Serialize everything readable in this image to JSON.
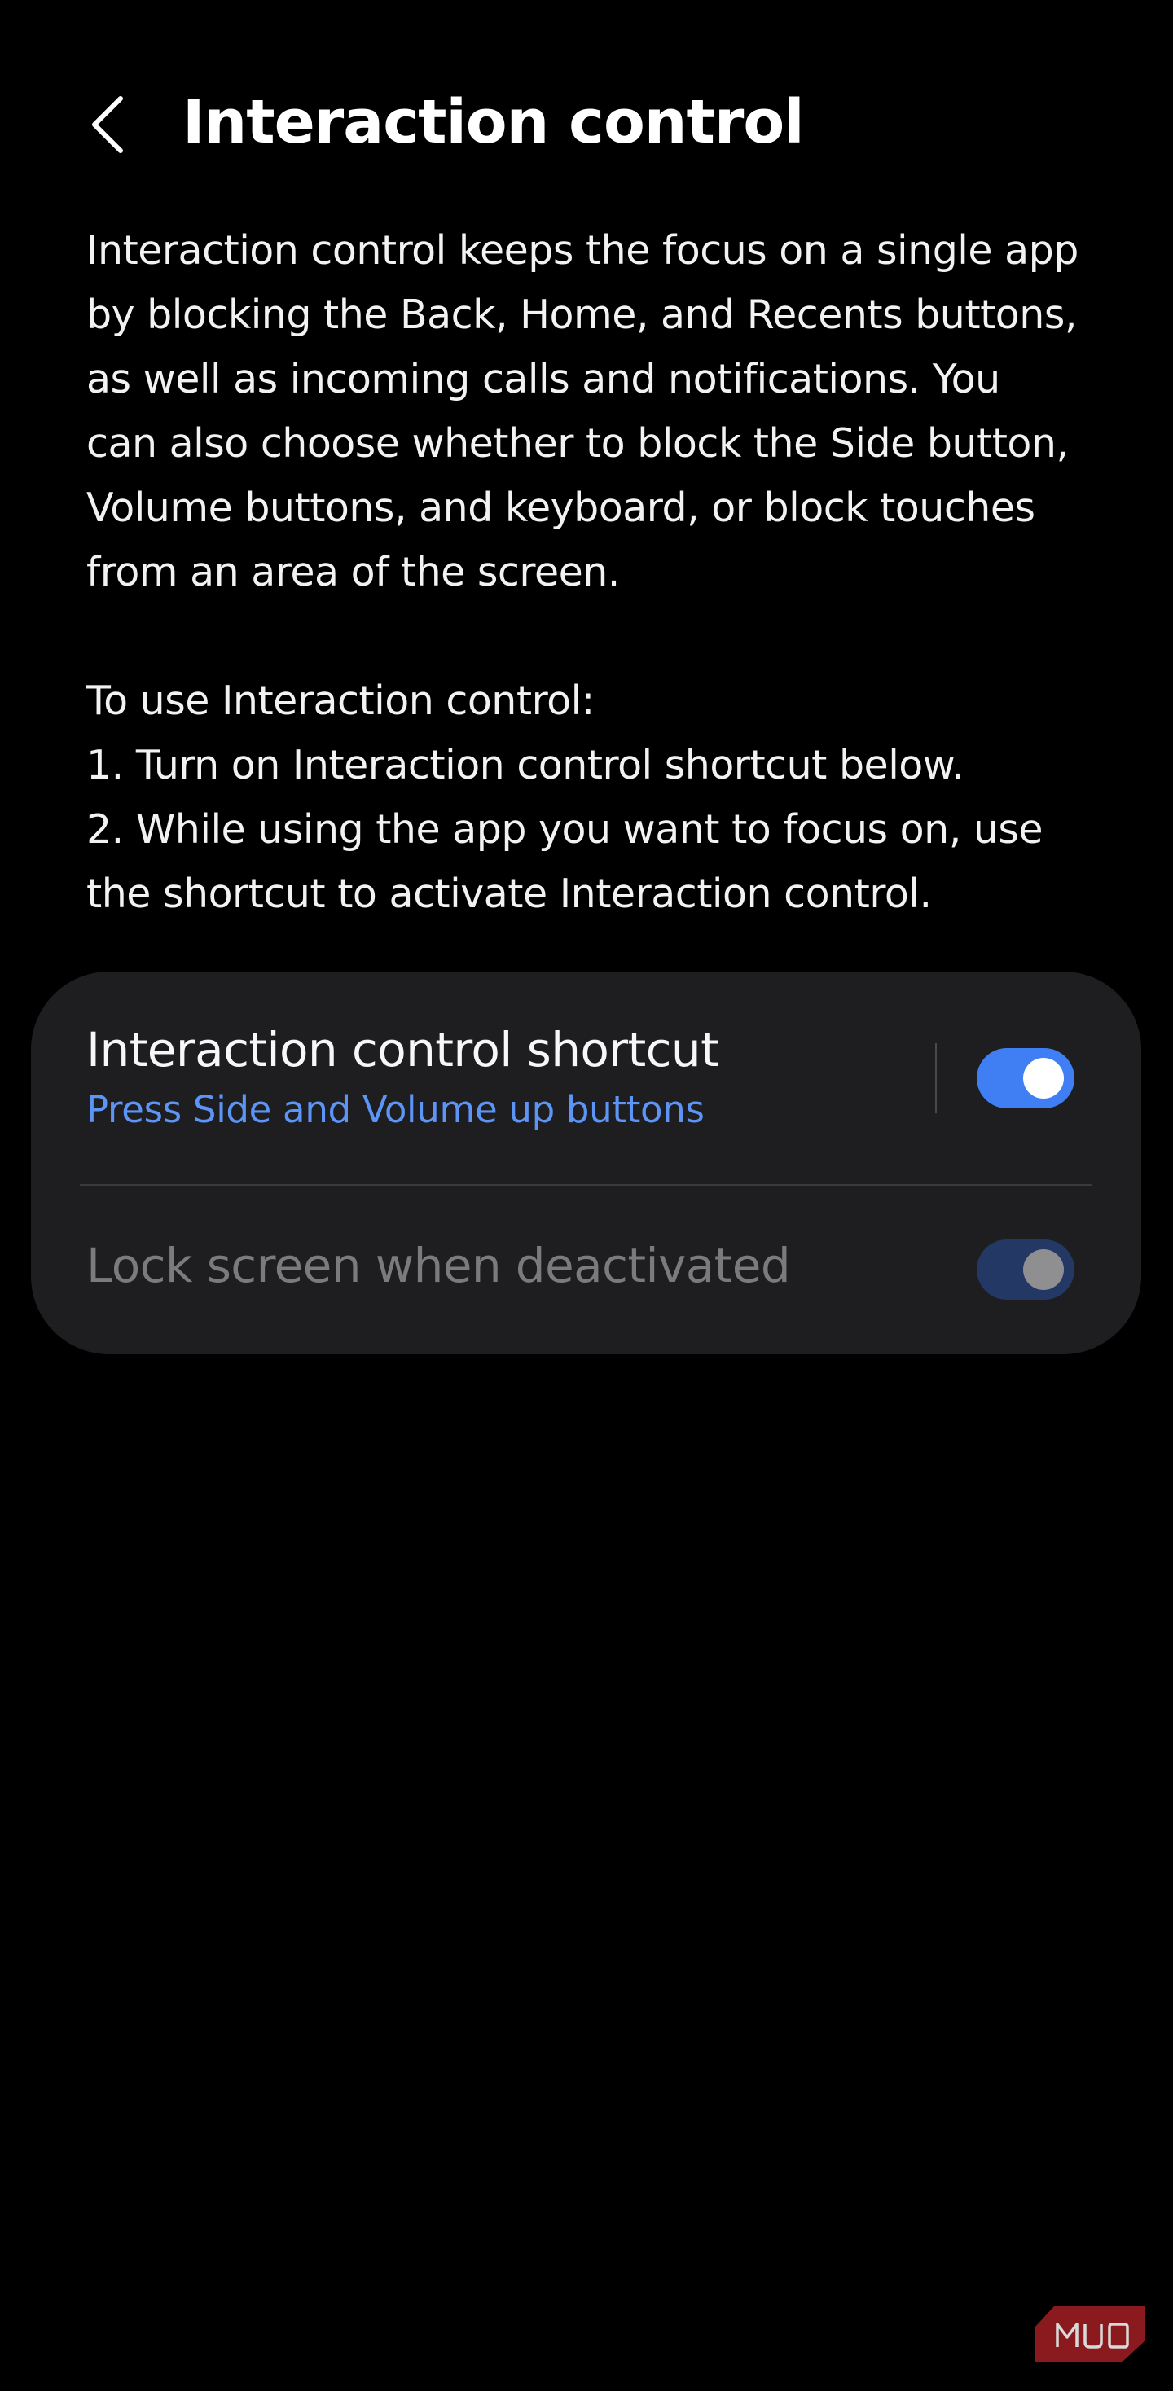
{
  "header": {
    "back_icon": "chevron-left-icon",
    "title": "Interaction control"
  },
  "description": {
    "paragraph1": "Interaction control keeps the focus on a single app\nby blocking the Back, Home, and Recents buttons,\nas well as incoming calls and notifications. You\ncan also choose whether to block the Side button,\nVolume buttons, and keyboard, or block touches\nfrom an area of the screen.",
    "paragraph2": "To use Interaction control:\n1. Turn on Interaction control shortcut below.\n2. While using the app you want to focus on, use\nthe shortcut to activate Interaction control."
  },
  "settings": {
    "shortcut": {
      "title": "Interaction control shortcut",
      "subtitle": "Press Side and Volume up buttons",
      "enabled": true
    },
    "lock_screen": {
      "title": "Lock screen when deactivated",
      "enabled": true,
      "disabled_state": true
    }
  },
  "watermark": {
    "text": "MUO"
  },
  "colors": {
    "background": "#000000",
    "card": "#1e1e20",
    "accent": "#3f7ef3",
    "subtitle": "#5d95f6",
    "muted_text": "#7b7b7d",
    "watermark": "#8b1a1f"
  }
}
